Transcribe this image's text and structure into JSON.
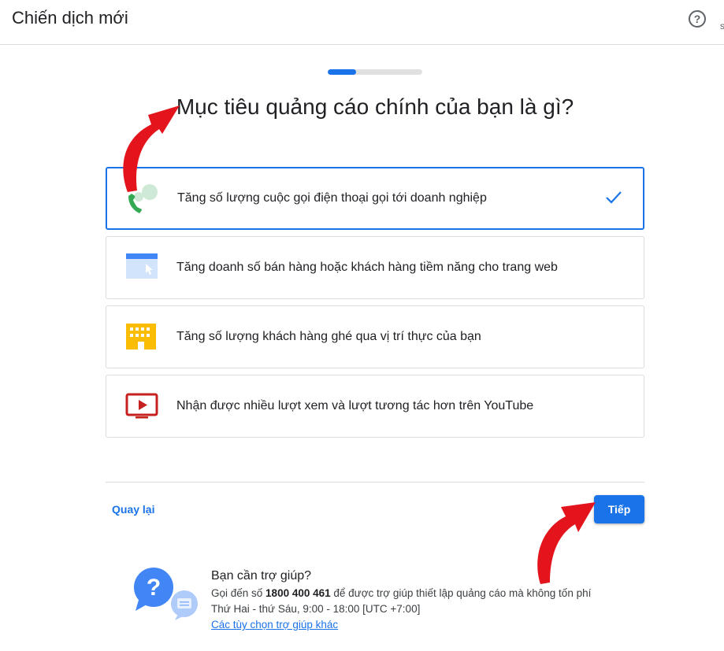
{
  "header": {
    "title": "Chiến dịch mới",
    "help_icon_glyph": "?",
    "edge_glyph": "s"
  },
  "progress": {
    "value": 0.3,
    "color": "#1a73e8"
  },
  "heading": "Mục tiêu quảng cáo chính của bạn là gì?",
  "options": [
    {
      "label": "Tăng số lượng cuộc gọi điện thoại gọi tới doanh nghiệp",
      "icon": "phone-call-icon",
      "selected": true
    },
    {
      "label": "Tăng doanh số bán hàng hoặc khách hàng tiềm năng cho trang web",
      "icon": "website-icon",
      "selected": false
    },
    {
      "label": "Tăng số lượng khách hàng ghé qua vị trí thực của bạn",
      "icon": "store-building-icon",
      "selected": false
    },
    {
      "label": "Nhận được nhiều lượt xem và lượt tương tác hơn trên YouTube",
      "icon": "youtube-play-icon",
      "selected": false
    }
  ],
  "footer": {
    "back_label": "Quay lại",
    "next_label": "Tiếp"
  },
  "help": {
    "title": "Bạn cần trợ giúp?",
    "line1_prefix": "Gọi đến số ",
    "phone": "1800 400 461",
    "line1_suffix": " để được trợ giúp thiết lập quảng cáo mà không tốn phí",
    "hours": "Thứ Hai - thứ Sáu, 9:00 - 18:00 [UTC +7:00]",
    "link": "Các tùy chọn trợ giúp khác"
  },
  "colors": {
    "accent": "#1a73e8",
    "annotation_arrow": "#e3141b"
  }
}
